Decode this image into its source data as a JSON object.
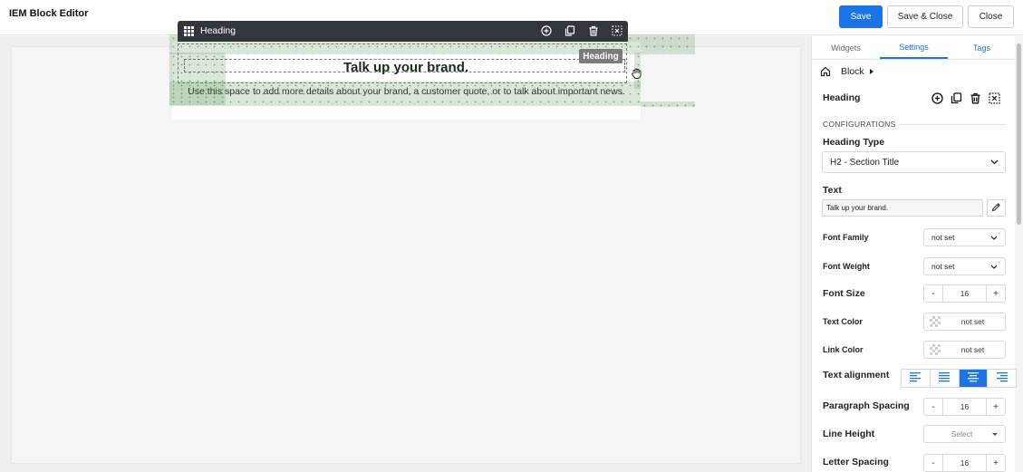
{
  "app": {
    "title": "IEM Block Editor",
    "actions": {
      "save": "Save",
      "save_close": "Save & Close",
      "close": "Close"
    }
  },
  "colors": {
    "accent": "#1a73e8",
    "toolbar": "#33363b",
    "canvas": "#f5f5f5"
  },
  "canvas": {
    "toolbar_title": "Heading",
    "toolbar_icons": [
      "grid-icon",
      "add-circle-icon",
      "duplicate-icon",
      "trash-icon",
      "deselect-icon"
    ],
    "heading_text": "Talk up your brand.",
    "heading_badge": "Heading",
    "paragraph_text": "Use this space to add more details about your brand, a customer quote, or to talk about important news."
  },
  "panel": {
    "tabs": [
      "Widgets",
      "Settings",
      "Tags"
    ],
    "active_tab": "Settings",
    "breadcrumb": "Block",
    "block_title": "Heading",
    "section_label": "CONFIGURATIONS",
    "heading_type": {
      "label": "Heading Type",
      "value": "H2 - Section Title"
    },
    "text": {
      "label": "Text",
      "value": "Talk up your brand."
    },
    "font_family": {
      "label": "Font Family",
      "value": "not set"
    },
    "font_weight": {
      "label": "Font Weight",
      "value": "not set"
    },
    "font_size": {
      "label": "Font Size",
      "value": "16",
      "minus": "-",
      "plus": "+"
    },
    "text_color": {
      "label": "Text Color",
      "value": "not set"
    },
    "link_color": {
      "label": "Link Color",
      "value": "not set"
    },
    "text_alignment": {
      "label": "Text alignment",
      "options": [
        "left",
        "justify",
        "center",
        "right"
      ],
      "selected": "center"
    },
    "paragraph_spacing": {
      "label": "Paragraph Spacing",
      "value": "16",
      "minus": "-",
      "plus": "+"
    },
    "line_height": {
      "label": "Line Height",
      "value": "Select"
    },
    "letter_spacing": {
      "label": "Letter Spacing",
      "value": "16",
      "minus": "-",
      "plus": "+"
    }
  }
}
